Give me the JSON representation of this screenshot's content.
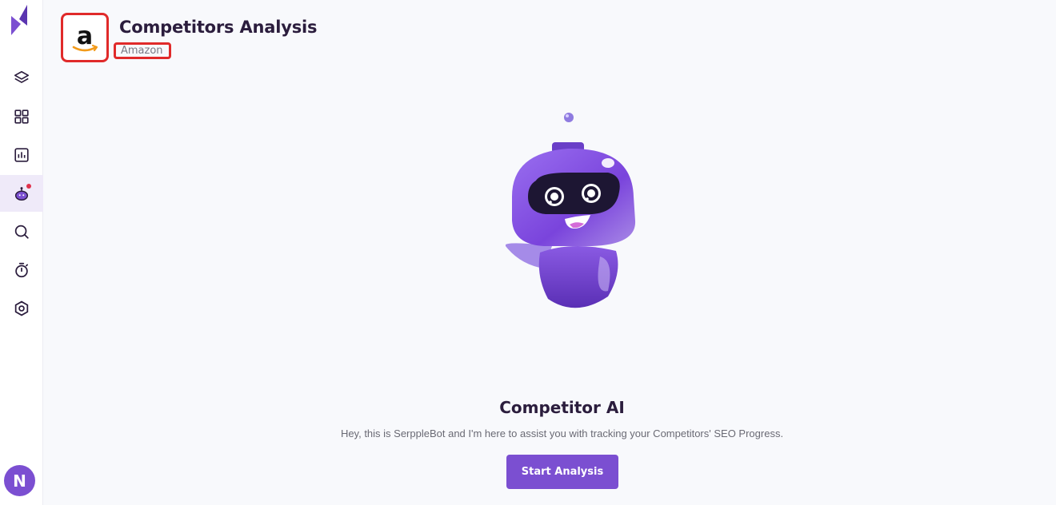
{
  "header": {
    "title": "Competitors Analysis",
    "competitor_name": "Amazon",
    "competitor_logo_icon": "amazon-logo"
  },
  "sidebar": {
    "items": [
      {
        "icon": "layers-icon"
      },
      {
        "icon": "grid-icon"
      },
      {
        "icon": "bar-chart-icon"
      },
      {
        "icon": "bot-icon",
        "active": true,
        "badge": true
      },
      {
        "icon": "search-icon"
      },
      {
        "icon": "timer-icon"
      },
      {
        "icon": "settings-icon"
      }
    ],
    "avatar_initial": "N"
  },
  "main": {
    "heading": "Competitor AI",
    "description": "Hey, this is SerppleBot and I'm here to assist you with tracking your Competitors' SEO Progress.",
    "start_button_label": "Start Analysis"
  },
  "colors": {
    "accent": "#7b4fd1",
    "highlight_border": "#e02a2a",
    "badge": "#e0314b"
  }
}
